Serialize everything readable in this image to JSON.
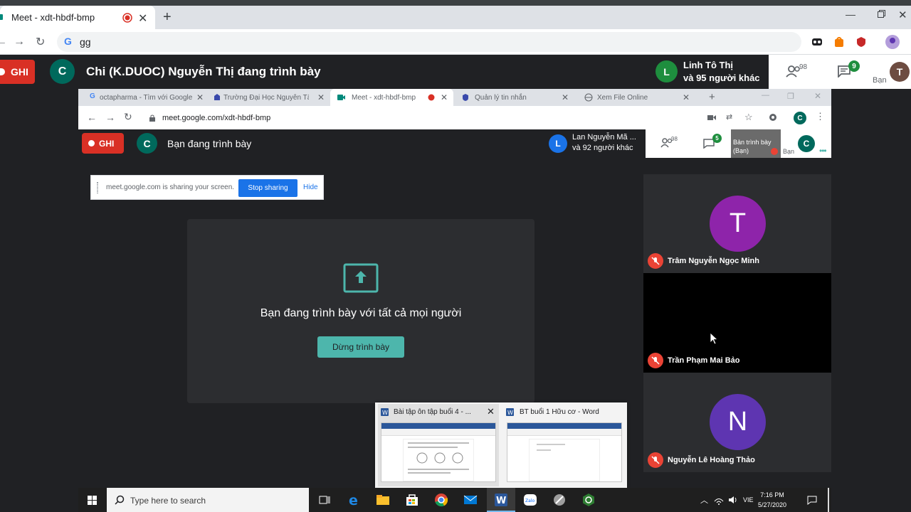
{
  "outer_browser": {
    "tab_title": "Meet - xdt-hbdf-bmp",
    "omnibox_text": "gg"
  },
  "outer_meet": {
    "recording_label": "GHI",
    "presenter_avatar": "C",
    "presenter_text": "Chi (K.DUOC) Nguyễn Thị đang trình bày",
    "participant_avatar": "L",
    "participant_name": "Linh Tô Thị",
    "participant_more": "và 95 người khác",
    "people_count": "98",
    "chat_count": "9",
    "self_label": "Bạn",
    "self_avatar": "T"
  },
  "inner_browser": {
    "tabs": [
      {
        "title": "octapharma - Tìm với Google"
      },
      {
        "title": "Trường Đại Học Nguyễn Tất Thành"
      },
      {
        "title": "Meet - xdt-hbdf-bmp"
      },
      {
        "title": "Quản lý tin nhắn"
      },
      {
        "title": "Xem File Online"
      }
    ],
    "url": "meet.google.com/xdt-hbdf-bmp",
    "profile_avatar": "C"
  },
  "inner_meet": {
    "recording_label": "GHI",
    "presenter_avatar": "C",
    "presenter_text": "Bạn đang trình bày",
    "participant_avatar": "L",
    "participant_name": "Lan Nguyễn Mã ...",
    "participant_more": "và 92 người khác",
    "people_count": "98",
    "chat_count": "5",
    "self_tile_label": "Bản trình bày (Bạn)",
    "self_label": "Bạn",
    "self_avatar": "C"
  },
  "share_bar": {
    "text": "meet.google.com is sharing your screen.",
    "stop_label": "Stop sharing",
    "hide_label": "Hide"
  },
  "present_card": {
    "message": "Bạn đang trình bày với tất cả mọi người",
    "button_label": "Dừng trình bày"
  },
  "tiles": [
    {
      "avatar": "T",
      "name": "Trâm Nguyễn Ngọc Minh",
      "color": "#8e24aa"
    },
    {
      "avatar": "",
      "name": "Trần Phạm Mai Bảo",
      "color": ""
    },
    {
      "avatar": "N",
      "name": "Nguyễn Lê Hoàng Thảo",
      "color": "#5e35b1"
    }
  ],
  "thumbnails": [
    {
      "title": "Bài tập ôn tập buổi 4 - ..."
    },
    {
      "title": "BT buổi 1 Hữu cơ - Word"
    }
  ],
  "taskbar": {
    "search_placeholder": "Type here to search",
    "language": "VIE",
    "time": "7:16 PM",
    "date": "5/27/2020"
  },
  "colors": {
    "meet_dark": "#202124",
    "record_red": "#d93025",
    "accent_teal": "#4db6ac",
    "link_blue": "#1a73e8"
  }
}
